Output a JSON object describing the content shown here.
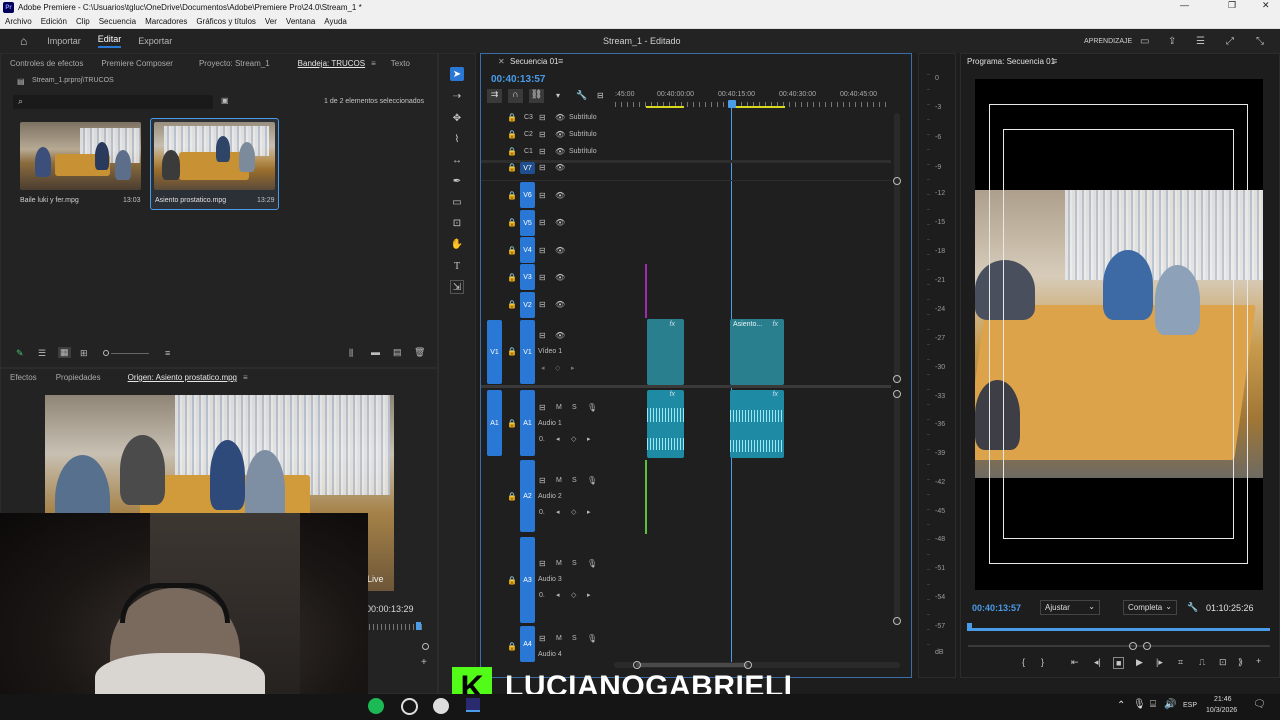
{
  "window": {
    "title": "Adobe Premiere - C:\\Usuarios\\tgluc\\OneDrive\\Documentos\\Adobe\\Premiere Pro\\24.0\\Stream_1 *",
    "logo": "Pr",
    "min": "—",
    "max": "❐",
    "close": "✕"
  },
  "menu": [
    "Archivo",
    "Edición",
    "Clip",
    "Secuencia",
    "Marcadores",
    "Gráficos y títulos",
    "Ver",
    "Ventana",
    "Ayuda"
  ],
  "workspace": {
    "home_icon": "home-icon",
    "import": "Importar",
    "edit": "Editar",
    "export": "Exportar",
    "project_title": "Stream_1 - Editado",
    "learning": "APRENDIZAJE"
  },
  "project_panel": {
    "tabs": [
      "Controles de efectos",
      "Premiere Composer",
      "Proyecto: Stream_1",
      "Bandeja: TRUCOS",
      "Texto"
    ],
    "active_tab": "Bandeja: TRUCOS",
    "path": "Stream_1.prproj\\TRUCOS",
    "search_placeholder": "",
    "selection_info": "1 de 2 elementos seleccionados",
    "items": [
      {
        "name": "Baile luki y fer.mpg",
        "duration": "13:03"
      },
      {
        "name": "Asiento prostatico.mpg",
        "duration": "13:29"
      }
    ]
  },
  "source_panel": {
    "tabs": [
      "Efectos",
      "Propiedades",
      "Origen: Asiento prostatico.mpg"
    ],
    "timecode": "00:00:13:29",
    "live_label": "Live"
  },
  "sequence": {
    "tab": "Secuencia 01",
    "timecode": "00:40:13:57",
    "ruler": [
      ":45:00",
      "00:40:00:00",
      "00:40:15:00",
      "00:40:30:00",
      "00:40:45:00"
    ],
    "caption_tracks": [
      {
        "id": "C3",
        "name": "Subtítulo"
      },
      {
        "id": "C2",
        "name": "Subtítulo"
      },
      {
        "id": "C1",
        "name": "Subtítulo"
      }
    ],
    "video_tracks": [
      "V7",
      "V6",
      "V5",
      "V4",
      "V3",
      "V2"
    ],
    "v1": {
      "src": "V1",
      "id": "V1",
      "name": "Vídeo 1"
    },
    "audio_tracks": [
      {
        "src": "A1",
        "id": "A1",
        "name": "Audio 1"
      },
      {
        "src": "",
        "id": "A2",
        "name": "Audio 2"
      },
      {
        "src": "",
        "id": "A3",
        "name": "Audio 3"
      },
      {
        "src": "",
        "id": "A4",
        "name": "Audio 4"
      }
    ],
    "clip_label": "Asiento...",
    "fx": "fx",
    "m_label": "M",
    "s_label": "S",
    "vol_label": "0."
  },
  "meter": {
    "scale": [
      "0",
      "-3",
      "-6",
      "-9",
      "-12",
      "-15",
      "-18",
      "-21",
      "-24",
      "-27",
      "-30",
      "-33",
      "-36",
      "-39",
      "-42",
      "-45",
      "-48",
      "-51",
      "-54",
      "-57",
      "dB"
    ]
  },
  "program_panel": {
    "tab": "Programa: Secuencia 01",
    "timecode": "00:40:13:57",
    "fit": "Ajustar",
    "quality": "Completa",
    "duration": "01:10:25:26"
  },
  "overlay": {
    "channel_name": "LUCIANOGABRIELI",
    "logo_letter": "K"
  },
  "taskbar": {
    "lang": "ESP",
    "time": "21:46",
    "date": "10/3/2026"
  },
  "colors": {
    "accent": "#2a78d6",
    "clip_video": "#2a7f8e",
    "clip_audio": "#1e8aa3",
    "playhead": "#4a9be8",
    "kick_green": "#53fc18"
  }
}
